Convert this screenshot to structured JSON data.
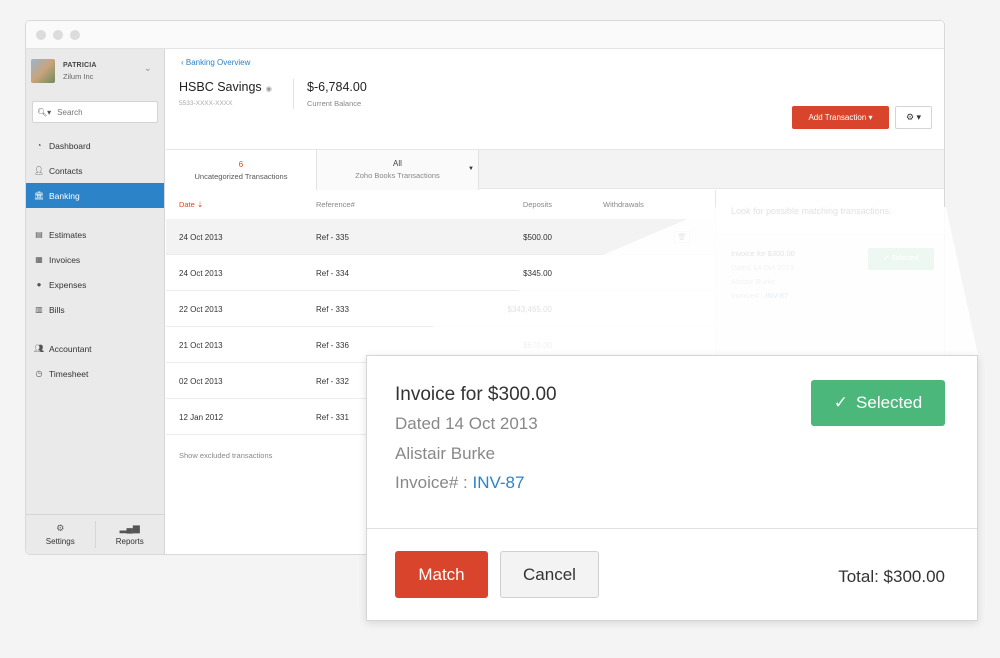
{
  "sidebar": {
    "org_name": "PATRICIA",
    "org_sub": "Zilum Inc",
    "search_placeholder": "Search",
    "items": [
      {
        "label": "Dashboard",
        "icon": "dashboard-icon"
      },
      {
        "label": "Contacts",
        "icon": "user-icon"
      },
      {
        "label": "Banking",
        "icon": "bank-icon",
        "active": true
      },
      {
        "label": "Estimates",
        "icon": "estimate-icon"
      },
      {
        "label": "Invoices",
        "icon": "invoice-icon"
      },
      {
        "label": "Expenses",
        "icon": "expense-icon"
      },
      {
        "label": "Bills",
        "icon": "bill-icon"
      },
      {
        "label": "Accountant",
        "icon": "accountant-icon"
      },
      {
        "label": "Timesheet",
        "icon": "timesheet-icon"
      }
    ],
    "bottom": {
      "settings": "Settings",
      "reports": "Reports"
    }
  },
  "header": {
    "breadcrumb": "Banking Overview",
    "account_name": "HSBC Savings",
    "account_number": "5533-XXXX-XXXX",
    "balance": "$-6,784.00",
    "balance_label": "Current Balance",
    "add_transaction": "Add Transaction ▾",
    "gear": "⚙ ▾"
  },
  "tabs": [
    {
      "count": "6",
      "label": "Uncategorized Transactions"
    },
    {
      "count": "All",
      "label": "Zoho Books Transactions"
    }
  ],
  "table": {
    "columns": {
      "date": "Date ⇣",
      "reference": "Reference#",
      "deposits": "Deposits",
      "withdrawals": "Withdrawals"
    },
    "rows": [
      {
        "date": "24 Oct 2013",
        "ref": "Ref - 335",
        "deposit": "$500.00"
      },
      {
        "date": "24 Oct 2013",
        "ref": "Ref - 334",
        "deposit": "$345.00"
      },
      {
        "date": "22 Oct 2013",
        "ref": "Ref - 333",
        "deposit": "$343,465.00"
      },
      {
        "date": "21 Oct 2013",
        "ref": "Ref - 336",
        "deposit": "$670.00"
      },
      {
        "date": "02 Oct 2013",
        "ref": "Ref - 332",
        "deposit": ""
      },
      {
        "date": "12 Jan 2012",
        "ref": "Ref - 331",
        "deposit": ""
      }
    ],
    "show_excluded": "Show excluded transactions"
  },
  "match_panel": {
    "heading": "Look for possible matching transactions.",
    "title": "Invoice for $300.00",
    "dated": "Dated 14 Oct 2013",
    "customer": "Alistair Burke",
    "invoice_label": "Invoice# : ",
    "invoice_link": "INV-87",
    "selected": "✓ Selected"
  },
  "popup": {
    "title": "Invoice for $300.00",
    "dated": "Dated 14 Oct 2013",
    "customer": "Alistair Burke",
    "invoice_label": "Invoice# : ",
    "invoice_link": "INV-87",
    "selected_check": "✓",
    "selected_label": "Selected",
    "match": "Match",
    "cancel": "Cancel",
    "total": "Total: $300.00"
  },
  "colors": {
    "accent_red": "#d9452c",
    "accent_blue": "#2c83c7",
    "selected_green": "#4cb77a"
  }
}
